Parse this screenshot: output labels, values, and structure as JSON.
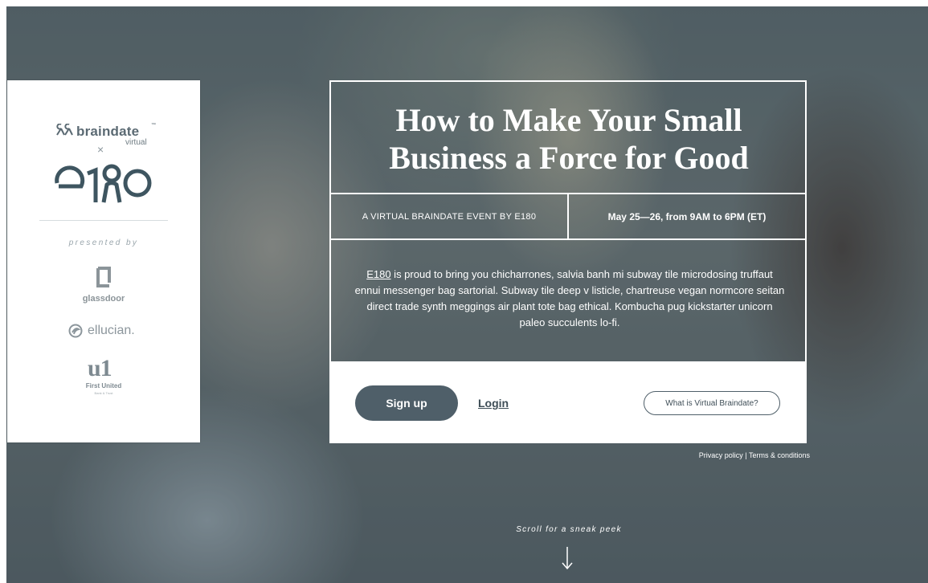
{
  "colors": {
    "accent": "#4f5f69",
    "panel": "#ffffff",
    "text_light": "#ffffff",
    "text_dark": "#3f4e57"
  },
  "sponsors": {
    "braindate": {
      "name": "braindate",
      "tm": "™",
      "sub": "virtual"
    },
    "separator": "×",
    "presented_by": "presented by",
    "glassdoor": "glassdoor",
    "ellucian": "ellucian.",
    "first_united": {
      "mark": "u1",
      "name": "First United",
      "sub": "Bank & Trust"
    }
  },
  "event": {
    "title_line1": "How to Make Your Small",
    "title_line2": "Business a Force for Good",
    "byline": "A VIRTUAL BRAINDATE EVENT BY E180",
    "dates": "May 25—26, from 9AM to 6PM (ET)",
    "description_link": "E180",
    "description": " is proud to bring you chicharrones, salvia banh mi subway tile microdosing truffaut ennui messenger bag sartorial. Subway tile deep v listicle, chartreuse vegan normcore seitan direct trade synth meggings air plant tote bag ethical. Kombucha pug kickstarter unicorn paleo succulents lo-fi."
  },
  "actions": {
    "signup": "Sign up",
    "login": "Login",
    "what_is": "What is Virtual Braindate?"
  },
  "footer": {
    "privacy": "Privacy policy",
    "separator": " | ",
    "terms": "Terms & conditions"
  },
  "scroll": {
    "prompt": "Scroll for a sneak peek",
    "arrow": "↓"
  }
}
